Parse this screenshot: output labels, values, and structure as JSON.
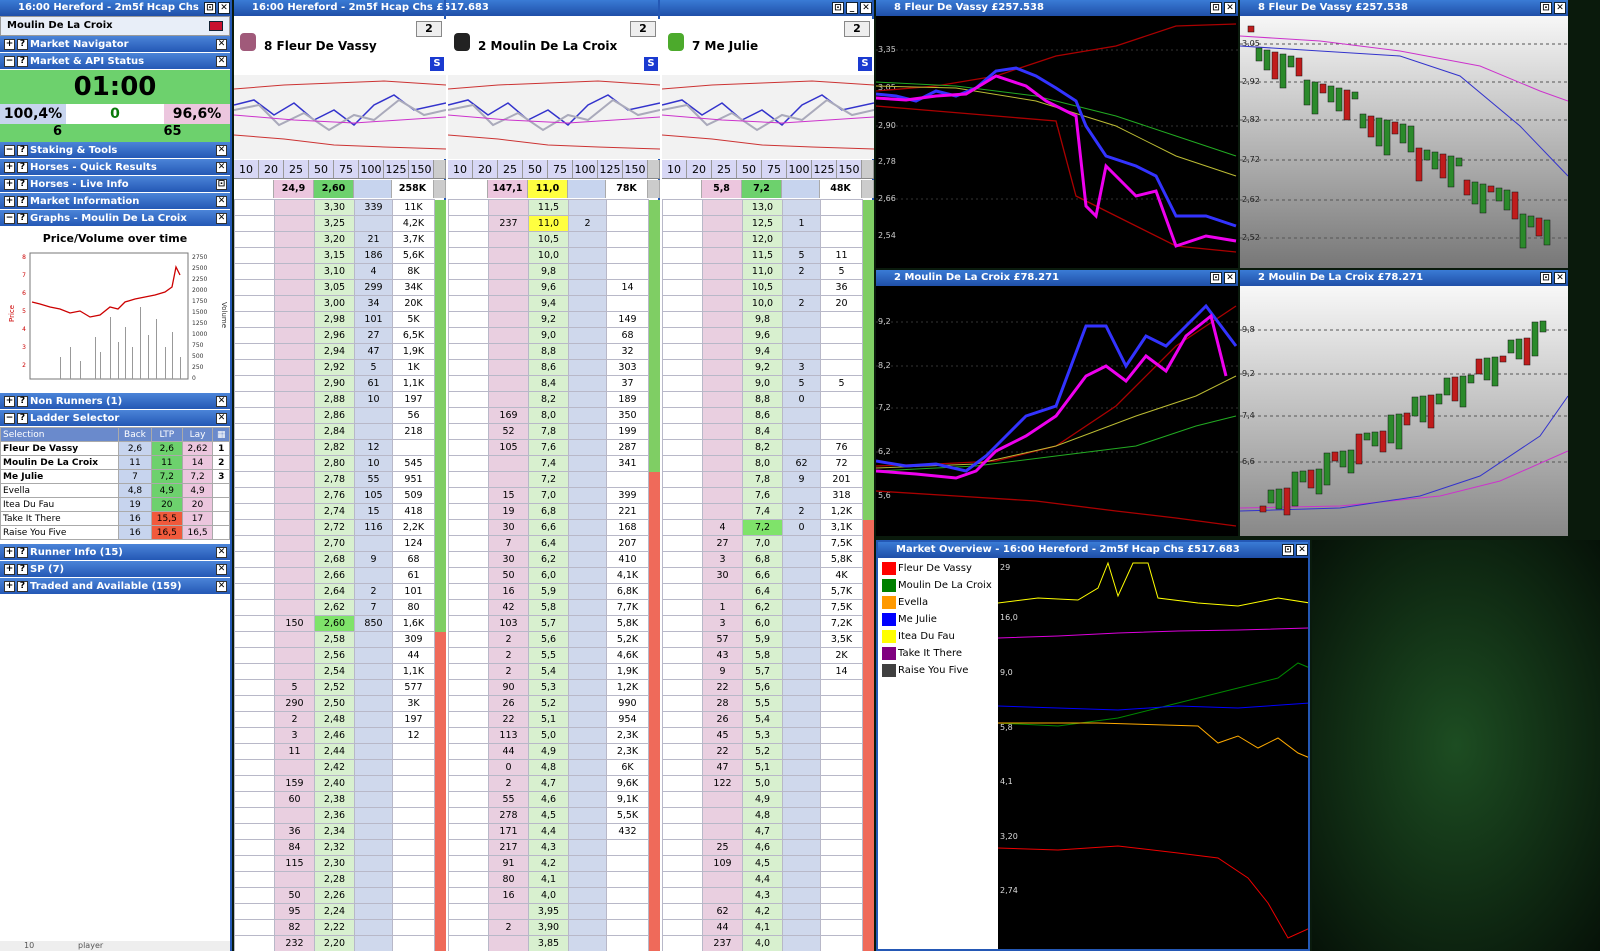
{
  "main_window": {
    "title": "16:00 Hereford - 2m5f Hcap Chs"
  },
  "left": {
    "selected_runner": "Moulin De La Croix",
    "sections": {
      "market_navigator": "Market Navigator",
      "market_api_status": "Market & API Status",
      "staking": "Staking & Tools",
      "quick_results": "Horses - Quick Results",
      "live_info": "Horses - Live Info",
      "market_information": "Market Information",
      "graphs": "Graphs - Moulin De La Croix",
      "non_runners": "Non Runners (1)",
      "ladder_selector": "Ladder Selector",
      "runner_info": "Runner Info (15)",
      "sp": "SP (7)",
      "traded": "Traded and Available (159)"
    },
    "status": {
      "countdown": "01:00",
      "back_pct": "100,4%",
      "mid": "0",
      "lay_pct": "96,6%",
      "left_num": "6",
      "right_num": "65"
    },
    "graph": {
      "title": "Price/Volume over time",
      "ylabel": "Price",
      "y2label": "Volume",
      "y_ticks": [
        "8",
        "7",
        "6",
        "5",
        "4",
        "3",
        "2"
      ],
      "y2_ticks": [
        "2750",
        "2500",
        "2250",
        "2000",
        "1750",
        "1500",
        "1250",
        "1000",
        "750",
        "500",
        "250",
        "0"
      ]
    },
    "selector": {
      "headers": [
        "Selection",
        "Back",
        "LTP",
        "Lay"
      ],
      "rows": [
        {
          "name": "Fleur De Vassy",
          "back": "2,6",
          "ltp": "2,6",
          "lay": "2,62",
          "n": "1"
        },
        {
          "name": "Moulin De La Croix",
          "back": "11",
          "ltp": "11",
          "lay": "14",
          "n": "2"
        },
        {
          "name": "Me Julie",
          "back": "7",
          "ltp": "7,2",
          "lay": "7,2",
          "n": "3"
        },
        {
          "name": "Evella",
          "back": "4,8",
          "ltp": "4,9",
          "lay": "4,9",
          "n": ""
        },
        {
          "name": "Itea Du Fau",
          "back": "19",
          "ltp": "20",
          "lay": "20",
          "n": ""
        },
        {
          "name": "Take It There",
          "back": "16",
          "ltp": "15,5",
          "lay": "17",
          "n": ""
        },
        {
          "name": "Raise You Five",
          "back": "16",
          "ltp": "16,5",
          "lay": "16,5",
          "n": ""
        }
      ]
    },
    "footer": {
      "a": "10",
      "b": "player"
    }
  },
  "ladder_window": {
    "title": "16:00  Hereford - 2m5f Hcap Chs  £517.683"
  },
  "stake_scale": [
    "10",
    "20",
    "25",
    "50",
    "75",
    "100",
    "125",
    "150"
  ],
  "ladders": [
    {
      "name": "8 Fleur De Vassy",
      "tab": "2",
      "back_total": "24,9",
      "ltp": "2,60",
      "lay_total": "",
      "matched": "258K",
      "rows": [
        [
          "",
          "3,30",
          "339",
          "11K"
        ],
        [
          "",
          "3,25",
          "",
          "4,2K"
        ],
        [
          "",
          "3,20",
          "21",
          "3,7K"
        ],
        [
          "",
          "3,15",
          "186",
          "5,6K"
        ],
        [
          "",
          "3,10",
          "4",
          "8K"
        ],
        [
          "",
          "3,05",
          "299",
          "34K"
        ],
        [
          "",
          "3,00",
          "34",
          "20K"
        ],
        [
          "",
          "2,98",
          "101",
          "5K"
        ],
        [
          "",
          "2,96",
          "27",
          "6,5K"
        ],
        [
          "",
          "2,94",
          "47",
          "1,9K"
        ],
        [
          "",
          "2,92",
          "5",
          "1K"
        ],
        [
          "",
          "2,90",
          "61",
          "1,1K"
        ],
        [
          "",
          "2,88",
          "10",
          "197"
        ],
        [
          "",
          "2,86",
          "",
          "56"
        ],
        [
          "",
          "2,84",
          "",
          "218"
        ],
        [
          "",
          "2,82",
          "12",
          ""
        ],
        [
          "",
          "2,80",
          "10",
          "545"
        ],
        [
          "",
          "2,78",
          "55",
          "951"
        ],
        [
          "",
          "2,76",
          "105",
          "509"
        ],
        [
          "",
          "2,74",
          "15",
          "418"
        ],
        [
          "",
          "2,72",
          "116",
          "2,2K"
        ],
        [
          "",
          "2,70",
          "",
          "124"
        ],
        [
          "",
          "2,68",
          "9",
          "68"
        ],
        [
          "",
          "2,66",
          "",
          "61"
        ],
        [
          "",
          "2,64",
          "2",
          "101"
        ],
        [
          "",
          "2,62",
          "7",
          "80"
        ],
        [
          "150",
          "2,60",
          "850",
          "1,6K"
        ],
        [
          "",
          "2,58",
          "",
          "309"
        ],
        [
          "",
          "2,56",
          "",
          "44"
        ],
        [
          "",
          "2,54",
          "",
          "1,1K"
        ],
        [
          "5",
          "2,52",
          "",
          "577"
        ],
        [
          "290",
          "2,50",
          "",
          "3K"
        ],
        [
          "2",
          "2,48",
          "",
          "197"
        ],
        [
          "3",
          "2,46",
          "",
          "12"
        ],
        [
          "11",
          "2,44",
          "",
          ""
        ],
        [
          "",
          "2,42",
          "",
          ""
        ],
        [
          "159",
          "2,40",
          "",
          ""
        ],
        [
          "60",
          "2,38",
          "",
          ""
        ],
        [
          "",
          "2,36",
          "",
          ""
        ],
        [
          "36",
          "2,34",
          "",
          ""
        ],
        [
          "84",
          "2,32",
          "",
          ""
        ],
        [
          "115",
          "2,30",
          "",
          ""
        ],
        [
          "",
          "2,28",
          "",
          ""
        ],
        [
          "50",
          "2,26",
          "",
          ""
        ],
        [
          "95",
          "2,24",
          "",
          ""
        ],
        [
          "82",
          "2,22",
          "",
          ""
        ],
        [
          "232",
          "2,20",
          "",
          ""
        ]
      ]
    },
    {
      "name": "2 Moulin De La Croix",
      "tab": "2",
      "back_total": "147,1",
      "ltp": "11,0",
      "lay_total": "",
      "matched": "78K",
      "rows": [
        [
          "",
          "11,5",
          "",
          ""
        ],
        [
          "237",
          "11,0",
          "2",
          ""
        ],
        [
          "",
          "10,5",
          "",
          ""
        ],
        [
          "",
          "10,0",
          "",
          ""
        ],
        [
          "",
          "9,8",
          "",
          ""
        ],
        [
          "",
          "9,6",
          "",
          "14"
        ],
        [
          "",
          "9,4",
          "",
          ""
        ],
        [
          "",
          "9,2",
          "",
          "149"
        ],
        [
          "",
          "9,0",
          "",
          "68"
        ],
        [
          "",
          "8,8",
          "",
          "32"
        ],
        [
          "",
          "8,6",
          "",
          "303"
        ],
        [
          "",
          "8,4",
          "",
          "37"
        ],
        [
          "",
          "8,2",
          "",
          "189"
        ],
        [
          "169",
          "8,0",
          "",
          "350"
        ],
        [
          "52",
          "7,8",
          "",
          "199"
        ],
        [
          "105",
          "7,6",
          "",
          "287"
        ],
        [
          "",
          "7,4",
          "",
          "341"
        ],
        [
          "",
          "7,2",
          "",
          ""
        ],
        [
          "15",
          "7,0",
          "",
          "399"
        ],
        [
          "19",
          "6,8",
          "",
          "221"
        ],
        [
          "30",
          "6,6",
          "",
          "168"
        ],
        [
          "7",
          "6,4",
          "",
          "207"
        ],
        [
          "30",
          "6,2",
          "",
          "410"
        ],
        [
          "50",
          "6,0",
          "",
          "4,1K"
        ],
        [
          "16",
          "5,9",
          "",
          "6,8K"
        ],
        [
          "42",
          "5,8",
          "",
          "7,7K"
        ],
        [
          "103",
          "5,7",
          "",
          "5,8K"
        ],
        [
          "2",
          "5,6",
          "",
          "5,2K"
        ],
        [
          "2",
          "5,5",
          "",
          "4,6K"
        ],
        [
          "2",
          "5,4",
          "",
          "1,9K"
        ],
        [
          "90",
          "5,3",
          "",
          "1,2K"
        ],
        [
          "26",
          "5,2",
          "",
          "990"
        ],
        [
          "22",
          "5,1",
          "",
          "954"
        ],
        [
          "113",
          "5,0",
          "",
          "2,3K"
        ],
        [
          "44",
          "4,9",
          "",
          "2,3K"
        ],
        [
          "0",
          "4,8",
          "",
          "6K"
        ],
        [
          "2",
          "4,7",
          "",
          "9,6K"
        ],
        [
          "55",
          "4,6",
          "",
          "9,1K"
        ],
        [
          "278",
          "4,5",
          "",
          "5,5K"
        ],
        [
          "171",
          "4,4",
          "",
          "432"
        ],
        [
          "217",
          "4,3",
          "",
          ""
        ],
        [
          "91",
          "4,2",
          "",
          ""
        ],
        [
          "80",
          "4,1",
          "",
          ""
        ],
        [
          "16",
          "4,0",
          "",
          ""
        ],
        [
          "",
          "3,95",
          "",
          ""
        ],
        [
          "2",
          "3,90",
          "",
          ""
        ],
        [
          "",
          "3,85",
          "",
          ""
        ]
      ]
    },
    {
      "name": "7 Me Julie",
      "tab": "2",
      "back_total": "5,8",
      "ltp": "7,2",
      "lay_total": "",
      "matched": "48K",
      "rows": [
        [
          "",
          "13,0",
          "",
          ""
        ],
        [
          "",
          "12,5",
          "1",
          ""
        ],
        [
          "",
          "12,0",
          "",
          ""
        ],
        [
          "",
          "11,5",
          "5",
          "11"
        ],
        [
          "",
          "11,0",
          "2",
          "5"
        ],
        [
          "",
          "10,5",
          "",
          "36"
        ],
        [
          "",
          "10,0",
          "2",
          "20"
        ],
        [
          "",
          "9,8",
          "",
          ""
        ],
        [
          "",
          "9,6",
          "",
          ""
        ],
        [
          "",
          "9,4",
          "",
          ""
        ],
        [
          "",
          "9,2",
          "3",
          ""
        ],
        [
          "",
          "9,0",
          "5",
          "5"
        ],
        [
          "",
          "8,8",
          "0",
          ""
        ],
        [
          "",
          "8,6",
          "",
          ""
        ],
        [
          "",
          "8,4",
          "",
          ""
        ],
        [
          "",
          "8,2",
          "",
          "76"
        ],
        [
          "",
          "8,0",
          "62",
          "72"
        ],
        [
          "",
          "7,8",
          "9",
          "201"
        ],
        [
          "",
          "7,6",
          "",
          "318"
        ],
        [
          "",
          "7,4",
          "2",
          "1,2K"
        ],
        [
          "4",
          "7,2",
          "0",
          "3,1K"
        ],
        [
          "27",
          "7,0",
          "",
          "7,5K"
        ],
        [
          "3",
          "6,8",
          "",
          "5,8K"
        ],
        [
          "30",
          "6,6",
          "",
          "4K"
        ],
        [
          "",
          "6,4",
          "",
          "5,7K"
        ],
        [
          "1",
          "6,2",
          "",
          "7,5K"
        ],
        [
          "3",
          "6,0",
          "",
          "7,2K"
        ],
        [
          "57",
          "5,9",
          "",
          "3,5K"
        ],
        [
          "43",
          "5,8",
          "",
          "2K"
        ],
        [
          "9",
          "5,7",
          "",
          "14"
        ],
        [
          "22",
          "5,6",
          "",
          ""
        ],
        [
          "28",
          "5,5",
          "",
          ""
        ],
        [
          "26",
          "5,4",
          "",
          ""
        ],
        [
          "45",
          "5,3",
          "",
          ""
        ],
        [
          "22",
          "5,2",
          "",
          ""
        ],
        [
          "47",
          "5,1",
          "",
          ""
        ],
        [
          "122",
          "5,0",
          "",
          ""
        ],
        [
          "",
          "4,9",
          "",
          ""
        ],
        [
          "",
          "4,8",
          "",
          ""
        ],
        [
          "",
          "4,7",
          "",
          ""
        ],
        [
          "25",
          "4,6",
          "",
          ""
        ],
        [
          "109",
          "4,5",
          "",
          ""
        ],
        [
          "",
          "4,4",
          "",
          ""
        ],
        [
          "",
          "4,3",
          "",
          ""
        ],
        [
          "62",
          "4,2",
          "",
          ""
        ],
        [
          "44",
          "4,1",
          "",
          ""
        ],
        [
          "237",
          "4,0",
          "",
          ""
        ]
      ]
    }
  ],
  "charts": {
    "c1": {
      "title": "8 Fleur De Vassy  £257.538",
      "ticks": [
        "3,05",
        "2,90",
        "2,78",
        "2,66",
        "2,54"
      ],
      "top_tick": "3,35"
    },
    "c2": {
      "title": "8 Fleur De Vassy  £257.538",
      "ticks": [
        "3,05",
        "2,92",
        "2,82",
        "2,72",
        "2,62",
        "2,52"
      ]
    },
    "c3": {
      "title": "2 Moulin De La Croix  £78.271",
      "ticks": [
        "9,2",
        "8,2",
        "7,2",
        "6,2",
        "5,6"
      ]
    },
    "c4": {
      "title": "2 Moulin De La Croix  £78.271",
      "ticks": [
        "9,8",
        "9,2",
        "7,4",
        "6,6"
      ]
    },
    "overview": {
      "title": "Market Overview - 16:00  Hereford - 2m5f Hcap Chs  £517.683",
      "ticks": [
        "29",
        "16,0",
        "9,0",
        "5,8",
        "4,1",
        "3,20",
        "2,74"
      ],
      "legend": [
        {
          "name": "Fleur De Vassy",
          "color": "#ff0000"
        },
        {
          "name": "Moulin De La Croix",
          "color": "#008000"
        },
        {
          "name": "Evella",
          "color": "#ff9900"
        },
        {
          "name": "Me Julie",
          "color": "#0000ff"
        },
        {
          "name": "Itea Du Fau",
          "color": "#ffff00"
        },
        {
          "name": "Take It There",
          "color": "#800080"
        },
        {
          "name": "Raise You Five",
          "color": "#404040"
        }
      ]
    }
  }
}
